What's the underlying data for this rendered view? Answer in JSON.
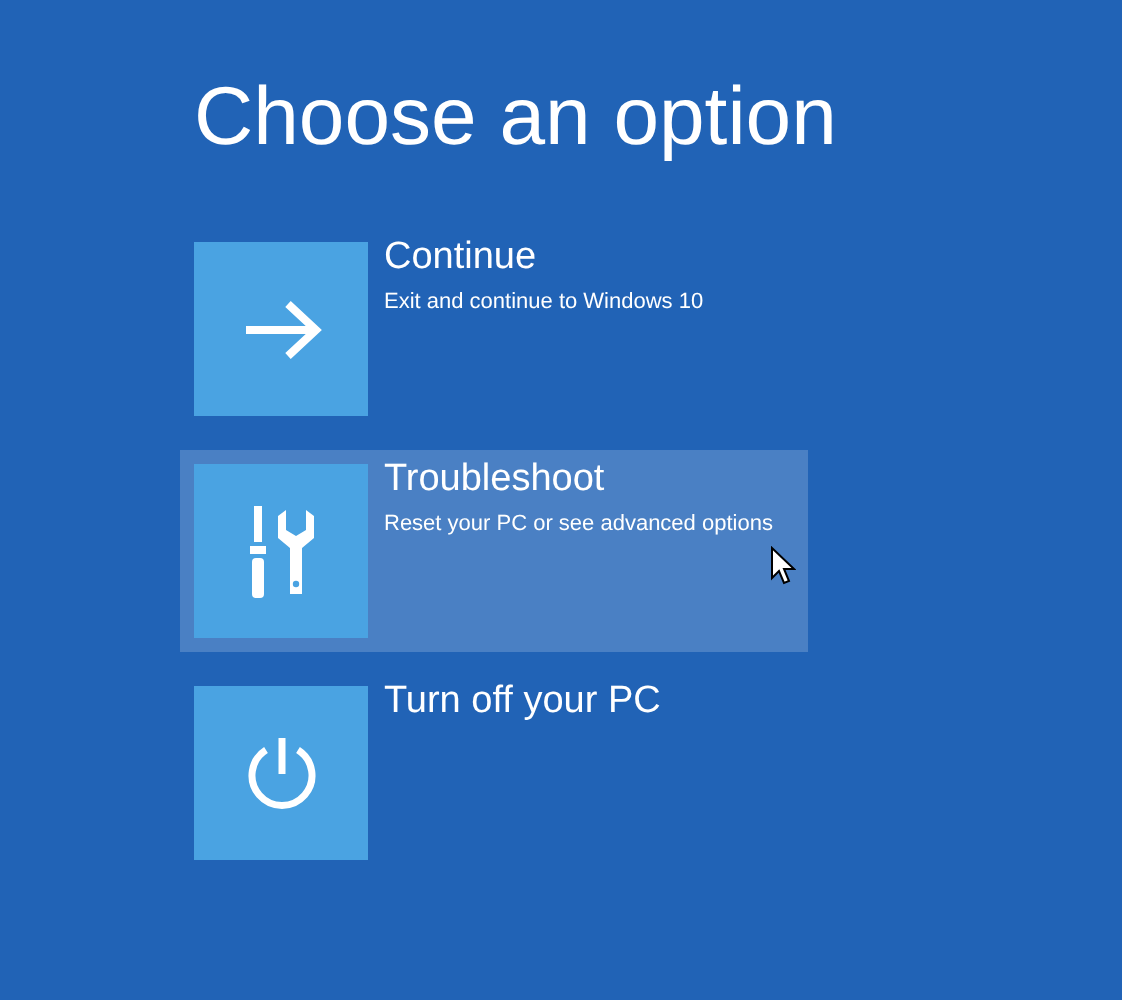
{
  "title": "Choose an option",
  "options": [
    {
      "kind": "arrow",
      "label": "Continue",
      "description": "Exit and continue to Windows 10",
      "selected": false
    },
    {
      "kind": "tools",
      "label": "Troubleshoot",
      "description": "Reset your PC or see advanced options",
      "selected": true
    },
    {
      "kind": "power",
      "label": "Turn off your PC",
      "selected": false
    }
  ]
}
